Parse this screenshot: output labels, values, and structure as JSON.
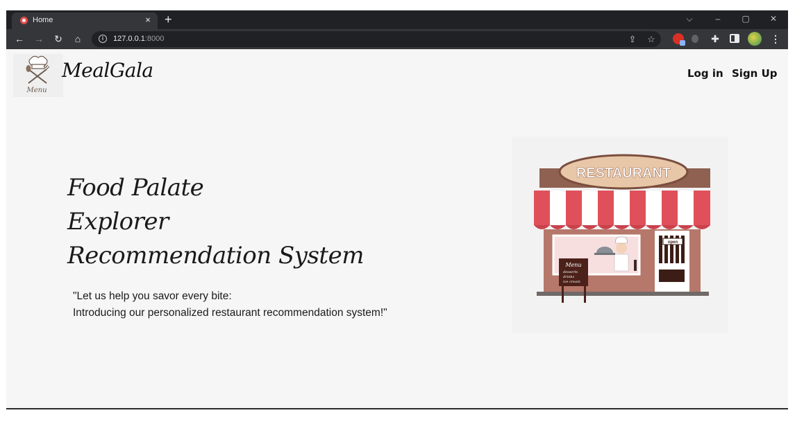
{
  "browser": {
    "tab_title": "Home",
    "tab_close": "×",
    "new_tab": "+",
    "url_host": "127.0.0.1",
    "url_port": ":8000",
    "window_controls": {
      "dropdown": "⌵",
      "minimize": "–",
      "restore": "▢",
      "close": "✕"
    },
    "nav": {
      "back": "←",
      "forward": "→",
      "reload": "↻",
      "home": "⌂"
    },
    "menu": "⋮"
  },
  "header": {
    "brand": "MealGala",
    "logo_text": "Menu",
    "login": "Log in",
    "signup": "Sign Up"
  },
  "hero": {
    "title_lines": [
      "Food Palate",
      "Explorer",
      "Recommendation System"
    ],
    "quote_lines": [
      "\"Let us help you savor every bite:",
      "Introducing our personalized restaurant recommendation system!\""
    ]
  },
  "illustration": {
    "sign_text": "RESTAURANT",
    "door_sign": "open",
    "menu_board": {
      "title": "Menu",
      "items": [
        "desserts",
        "drinks",
        "ice cream"
      ]
    }
  },
  "colors": {
    "chrome_dark": "#202124",
    "chrome_toolbar": "#35363a",
    "page_bg": "#f6f6f6",
    "awning_red": "#e0505a",
    "sign_brown": "#9a6a56",
    "wall_brown": "#b5786a"
  }
}
